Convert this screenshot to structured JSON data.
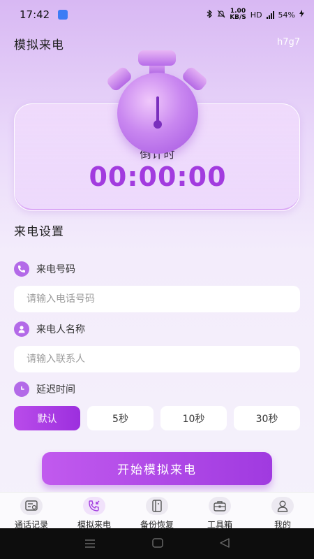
{
  "status_bar": {
    "time": "17:42",
    "speed_value": "1.00",
    "speed_unit": "KB/S",
    "network": "HD",
    "battery": "54%"
  },
  "header": {
    "title": "模拟来电",
    "user_tag": "h7g7"
  },
  "timer": {
    "label": "倒计时",
    "value": "00:00:00"
  },
  "settings": {
    "section_title": "来电设置",
    "phone": {
      "label": "来电号码",
      "placeholder": "请输入电话号码",
      "value": ""
    },
    "caller": {
      "label": "来电人名称",
      "placeholder": "请输入联系人",
      "value": ""
    },
    "delay": {
      "label": "延迟时间",
      "options": [
        "默认",
        "5秒",
        "10秒",
        "30秒"
      ],
      "selected_index": 0
    }
  },
  "start_button": "开始模拟来电",
  "tabs": [
    {
      "label": "通话记录",
      "icon": "call-log-icon"
    },
    {
      "label": "模拟来电",
      "icon": "incoming-call-icon"
    },
    {
      "label": "备份恢复",
      "icon": "backup-icon"
    },
    {
      "label": "工具箱",
      "icon": "toolbox-icon"
    },
    {
      "label": "我的",
      "icon": "profile-icon"
    }
  ],
  "active_tab_index": 1,
  "colors": {
    "accent": "#a23bdf",
    "button_gradient_start": "#c15aee",
    "button_gradient_end": "#a03ae0",
    "icon_bg": "#b36ae8"
  }
}
